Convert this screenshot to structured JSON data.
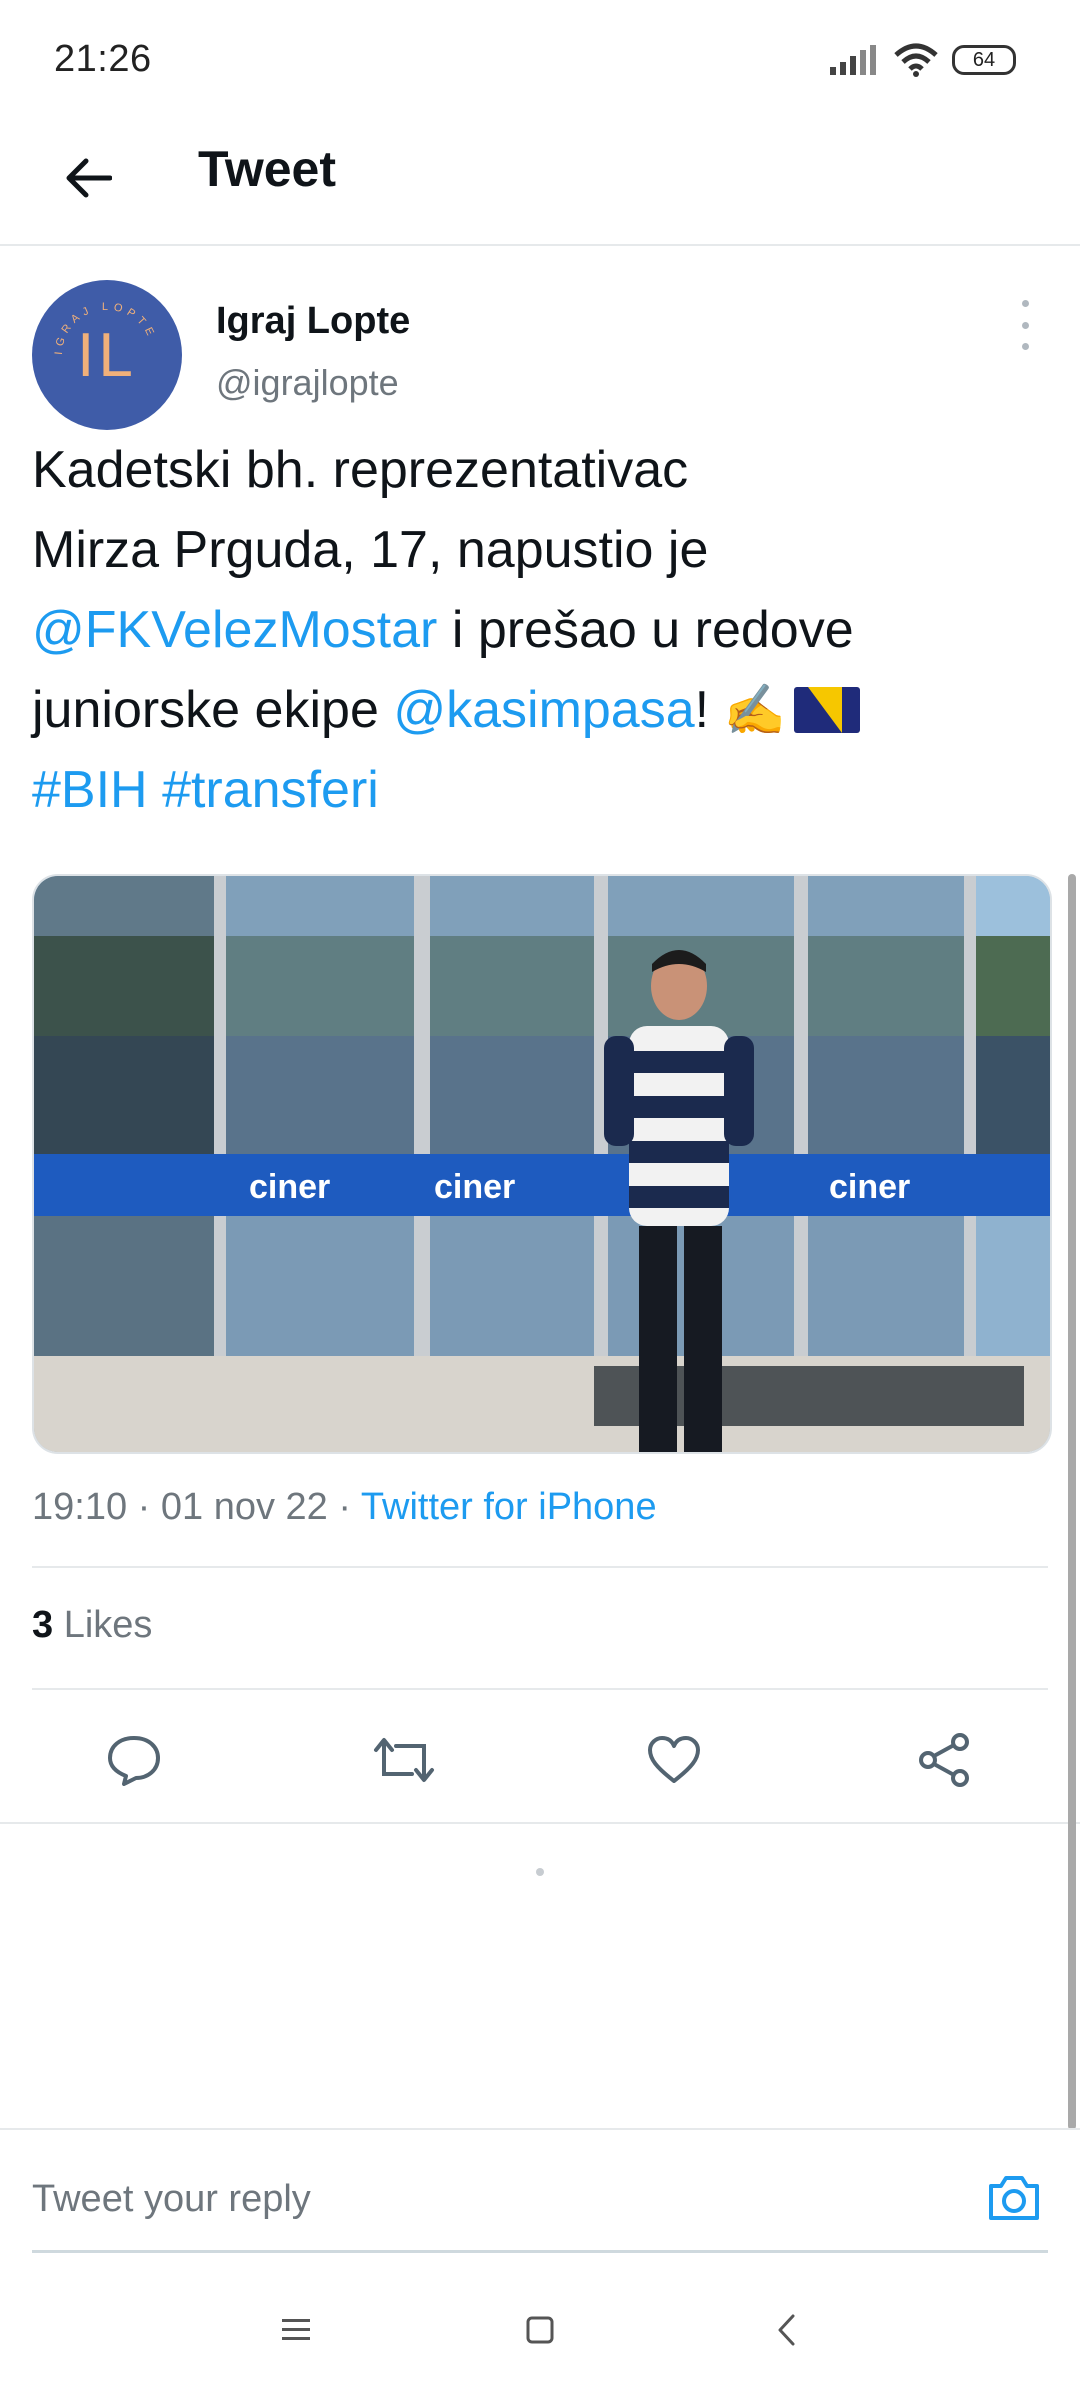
{
  "status_bar": {
    "time": "21:26",
    "battery": "64"
  },
  "header": {
    "title": "Tweet"
  },
  "tweet": {
    "author_name": "Igraj Lopte",
    "author_handle": "@igrajlopte",
    "avatar_initials": "IL",
    "avatar_ring_text": "IGRAJ LOPTE",
    "text_parts": {
      "line1": "Kadetski bh. reprezentativac",
      "line2": "Mirza Prguda, 17, napustio je",
      "mention1": "@FKVelezMostar",
      "line3_rest": " i prešao u redove",
      "line4_start": "juniorske ekipe ",
      "mention2": "@kasimpasa",
      "line4_end": "! ",
      "emoji_writing": "✍️",
      "hashtag1": "#BIH",
      "hashtag2": "#transferi"
    },
    "photo_sign_texts": [
      "ciner",
      "ciner",
      "ciner"
    ],
    "time": "19:10",
    "date": "01 nov 22",
    "source": "Twitter for iPhone",
    "likes_count": "3",
    "likes_label": "Likes"
  },
  "reply": {
    "placeholder": "Tweet your reply"
  },
  "icons": {
    "back": "arrow-left-icon",
    "more": "more-vertical-icon",
    "reply": "reply-icon",
    "retweet": "retweet-icon",
    "like": "heart-icon",
    "share": "share-icon",
    "camera": "camera-icon"
  },
  "colors": {
    "link": "#1d9bf0",
    "avatar_bg": "#3f5ca8",
    "avatar_text": "#f0b07a",
    "secondary_text": "#6e767d"
  }
}
